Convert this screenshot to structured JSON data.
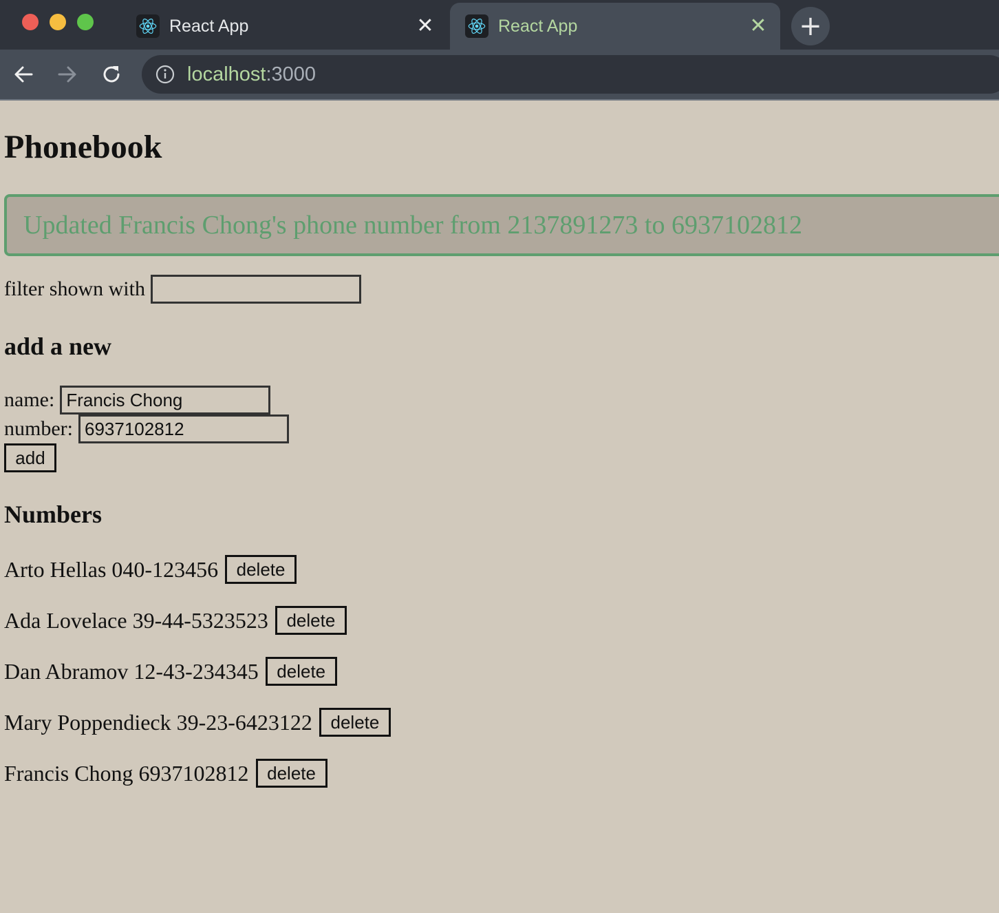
{
  "browser": {
    "tabs": [
      {
        "title": "React App",
        "active": false
      },
      {
        "title": "React App",
        "active": true
      }
    ],
    "url": {
      "host": "localhost",
      "port": ":3000"
    },
    "accent_color": "#b4d7a0"
  },
  "page": {
    "title": "Phonebook",
    "notification": {
      "message": "Updated Francis Chong's phone number from 2137891273 to 6937102812",
      "color": "#5e9e6f"
    },
    "filter": {
      "label": "filter shown with",
      "value": ""
    },
    "add_form": {
      "heading": "add a new",
      "name_label": "name:",
      "name_value": "Francis Chong",
      "number_label": "number:",
      "number_value": "6937102812",
      "submit_label": "add"
    },
    "numbers": {
      "heading": "Numbers",
      "delete_label": "delete",
      "persons": [
        {
          "entry": "Arto Hellas 040-123456"
        },
        {
          "entry": "Ada Lovelace 39-44-5323523"
        },
        {
          "entry": "Dan Abramov 12-43-234345"
        },
        {
          "entry": "Mary Poppendieck 39-23-6423122"
        },
        {
          "entry": "Francis Chong 6937102812"
        }
      ]
    }
  }
}
